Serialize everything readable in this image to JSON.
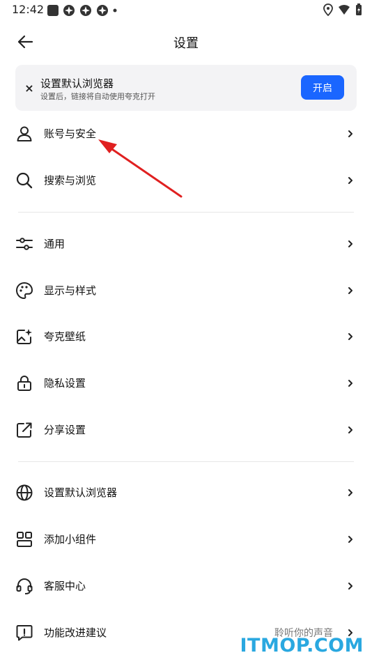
{
  "status_bar": {
    "time": "12:42"
  },
  "header": {
    "title": "设置"
  },
  "banner": {
    "close_icon": "×",
    "title": "设置默认浏览器",
    "subtitle": "设置后，链接将自动使用夸克打开",
    "button_label": "开启"
  },
  "groups": [
    [
      {
        "label": "账号与安全",
        "icon": "person-icon"
      },
      {
        "label": "搜索与浏览",
        "icon": "search-icon"
      }
    ],
    [
      {
        "label": "通用",
        "icon": "sliders-icon"
      },
      {
        "label": "显示与样式",
        "icon": "palette-icon"
      },
      {
        "label": "夸克壁纸",
        "icon": "wallpaper-icon"
      },
      {
        "label": "隐私设置",
        "icon": "lock-icon"
      },
      {
        "label": "分享设置",
        "icon": "share-icon"
      }
    ],
    [
      {
        "label": "设置默认浏览器",
        "icon": "globe-icon"
      },
      {
        "label": "添加小组件",
        "icon": "widget-icon"
      },
      {
        "label": "客服中心",
        "icon": "headset-icon"
      },
      {
        "label": "功能改进建议",
        "icon": "feedback-icon",
        "hint": "聆听你的声音"
      }
    ]
  ],
  "watermark": "ITMOP.COM",
  "colors": {
    "accent": "#1a66ff",
    "annotation_arrow": "#e02020",
    "watermark": "#2aa8e0"
  }
}
